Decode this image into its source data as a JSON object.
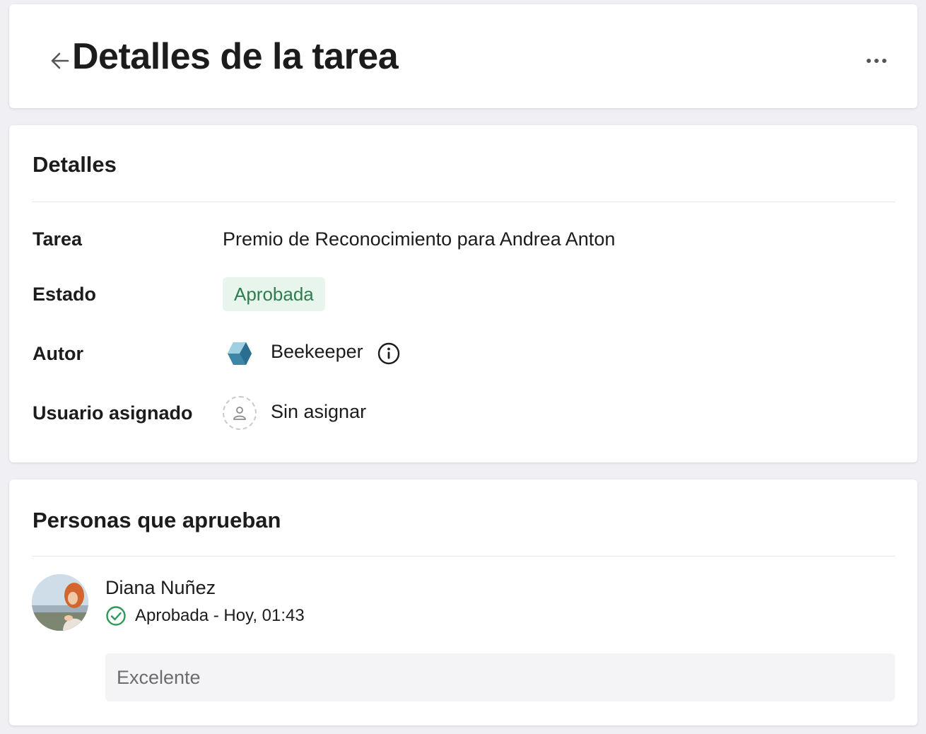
{
  "header": {
    "title": "Detalles de la tarea",
    "back_icon": "arrow-left-icon",
    "more_icon": "more-horizontal-icon"
  },
  "details": {
    "section_title": "Detalles",
    "rows": {
      "task": {
        "label": "Tarea",
        "value": "Premio de Reconocimiento para Andrea Anton"
      },
      "status": {
        "label": "Estado",
        "value": "Aprobada",
        "color": "#2e7d4f",
        "background": "#e8f5ec"
      },
      "author": {
        "label": "Autor",
        "value": "Beekeeper",
        "logo_icon": "beekeeper-logo-icon",
        "info_icon": "info-icon"
      },
      "assignee": {
        "label": "Usuario asignado",
        "value": "Sin asignar",
        "icon": "unassigned-user-icon"
      }
    }
  },
  "approvers": {
    "section_title": "Personas que aprueban",
    "items": [
      {
        "name": "Diana Nuñez",
        "status": "Aprobada - Hoy, 01:43",
        "status_icon": "check-circle-icon",
        "status_color": "#2e9a5a",
        "comment": "Excelente"
      }
    ]
  }
}
